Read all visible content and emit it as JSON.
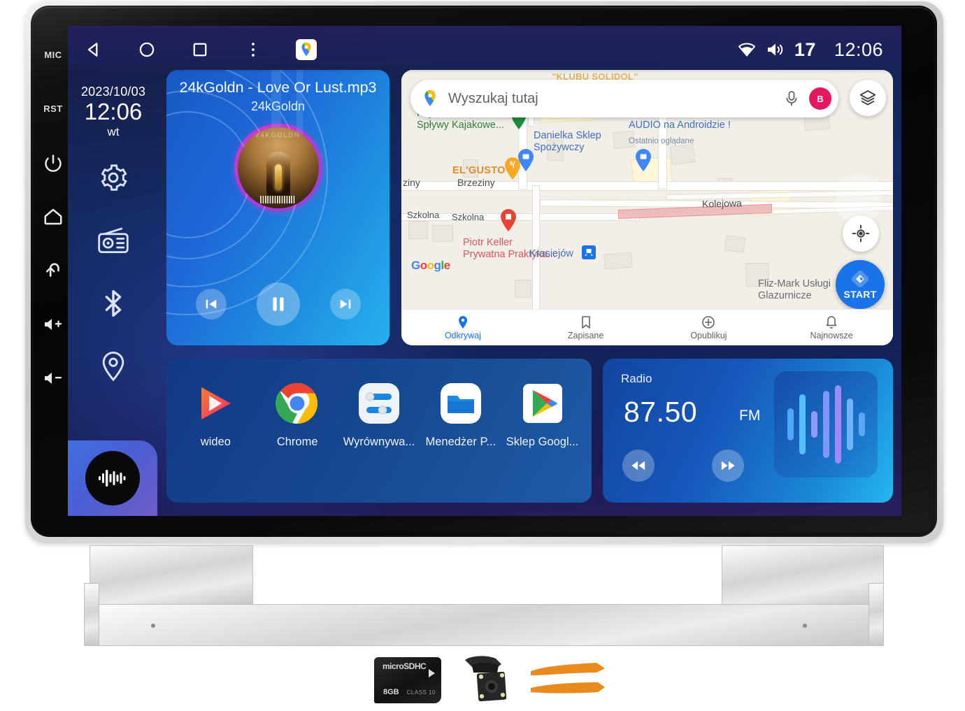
{
  "device": {
    "hardware_keys": [
      {
        "name": "mic-key",
        "label": "MIC",
        "type": "text"
      },
      {
        "name": "reset-key",
        "label": "RST",
        "type": "text"
      },
      {
        "name": "power-key",
        "label": "",
        "type": "power-icon"
      },
      {
        "name": "home-key",
        "label": "",
        "type": "home-icon"
      },
      {
        "name": "back-key",
        "label": "",
        "type": "back-icon"
      },
      {
        "name": "volume-up-key",
        "label": "",
        "type": "volume-up-icon"
      },
      {
        "name": "volume-down-key",
        "label": "",
        "type": "volume-down-icon"
      }
    ]
  },
  "statusbar": {
    "nav": [
      {
        "name": "nav-back",
        "icon": "triangle-left-icon"
      },
      {
        "name": "nav-home",
        "icon": "circle-icon"
      },
      {
        "name": "nav-recents",
        "icon": "square-icon"
      },
      {
        "name": "nav-overflow",
        "icon": "kebab-menu-icon"
      },
      {
        "name": "nav-maps-shortcut",
        "icon": "google-maps-icon"
      }
    ],
    "wifi_icon": "wifi-icon",
    "volume_icon": "volume-icon",
    "volume_level": "17",
    "clock": "12:06"
  },
  "rail": {
    "date": "2023/10/03",
    "time": "12:06",
    "weekday": "wt",
    "icons": [
      {
        "name": "settings-icon",
        "label": "settings"
      },
      {
        "name": "radio-icon",
        "label": "radio"
      },
      {
        "name": "bluetooth-icon",
        "label": "bluetooth"
      },
      {
        "name": "location-icon",
        "label": "navigation"
      }
    ],
    "dock_button": "waveform-icon"
  },
  "music": {
    "title": "24kGoldn - Love Or Lust.mp3",
    "artist": "24kGoldn",
    "album_art_alt": "24kGoldn album cover",
    "controls": {
      "previous": "skip-previous-icon",
      "play_pause": "pause-icon",
      "next": "skip-next-icon"
    }
  },
  "map": {
    "search": {
      "placeholder": "Wyszukaj tutaj",
      "maps_icon": "google-maps-icon",
      "mic_icon": "microphone-icon",
      "avatar_initial": "B"
    },
    "layers_icon": "layers-icon",
    "locate_icon": "my-location-icon",
    "start_button": {
      "label": "START",
      "icon": "navigation-arrow-icon"
    },
    "attribution": "Google",
    "clipped_top_label": "\"KLUBU SOLIDOL\"",
    "pois": [
      {
        "name": "poi-kajaki",
        "text": "Kajaki Krasieńka ·\nSpływy Kajakowe...",
        "color": "green"
      },
      {
        "name": "poi-danielka",
        "text": "Danielka Sklep\nSpożywczy",
        "color": "blue"
      },
      {
        "name": "poi-elgusto",
        "text": "EL'GUSTO",
        "color": "orange"
      },
      {
        "name": "poi-strefa-audio",
        "text": "Strefa Audio - CAR\nAUDIO na Androidzie !",
        "sub": "Ostatnio oglądane",
        "color": "blue"
      },
      {
        "name": "poi-piotr-keller",
        "text": "Piotr Keller\nPrywatna Praktyka...",
        "color": "red"
      },
      {
        "name": "poi-fliz-mark",
        "text": "Fliz-Mark Usługi\nGlazurnicze",
        "color": "gray"
      },
      {
        "name": "poi-krasiejow",
        "text": "Krasiejów",
        "color": "blue"
      }
    ],
    "roads": [
      {
        "name": "road-brzeziny",
        "label": "Brzeziny"
      },
      {
        "name": "road-brzeziny-left",
        "label": "ziny"
      },
      {
        "name": "road-szkolna-1",
        "label": "Szkolna"
      },
      {
        "name": "road-szkolna-2",
        "label": "Szkolna"
      },
      {
        "name": "road-kolejowa",
        "label": "Kolejowa"
      }
    ],
    "bottom_nav": [
      {
        "name": "mapnav-odkrywaj",
        "label": "Odkrywaj",
        "icon": "pin-icon",
        "active": true
      },
      {
        "name": "mapnav-zapisane",
        "label": "Zapisane",
        "icon": "bookmark-icon",
        "active": false
      },
      {
        "name": "mapnav-opublikuj",
        "label": "Opublikuj",
        "icon": "plus-circle-icon",
        "active": false
      },
      {
        "name": "mapnav-najnowsze",
        "label": "Najnowsze",
        "icon": "bell-icon",
        "active": false
      }
    ]
  },
  "apps": [
    {
      "name": "app-wideo",
      "label": "wideo",
      "icon": "video-player-icon"
    },
    {
      "name": "app-chrome",
      "label": "Chrome",
      "icon": "chrome-icon"
    },
    {
      "name": "app-equalizer",
      "label": "Wyrównywa...",
      "icon": "equalizer-icon"
    },
    {
      "name": "app-file-manager",
      "label": "Menedżer P...",
      "icon": "folder-icon"
    },
    {
      "name": "app-play-store",
      "label": "Sklep Googl...",
      "icon": "google-play-icon"
    }
  ],
  "radio": {
    "label": "Radio",
    "frequency": "87.50",
    "band": "FM",
    "prev_icon": "rewind-icon",
    "next_icon": "fast-forward-icon",
    "waveform_icon": "audio-waveform-icon"
  },
  "accessories": [
    {
      "name": "microsd-card",
      "label": "8GB",
      "brand": "microSDHC",
      "class": "CLASS 10"
    },
    {
      "name": "rear-camera",
      "label": ""
    },
    {
      "name": "pry-tools",
      "label": ""
    }
  ],
  "colors": {
    "accent_blue": "#1a73e8",
    "screen_blue": "#14265c",
    "card_blue": "#1759c4",
    "radio_blue": "#1246a0",
    "avatar_pink": "#e5175f",
    "art_ring": "#d838c8"
  }
}
